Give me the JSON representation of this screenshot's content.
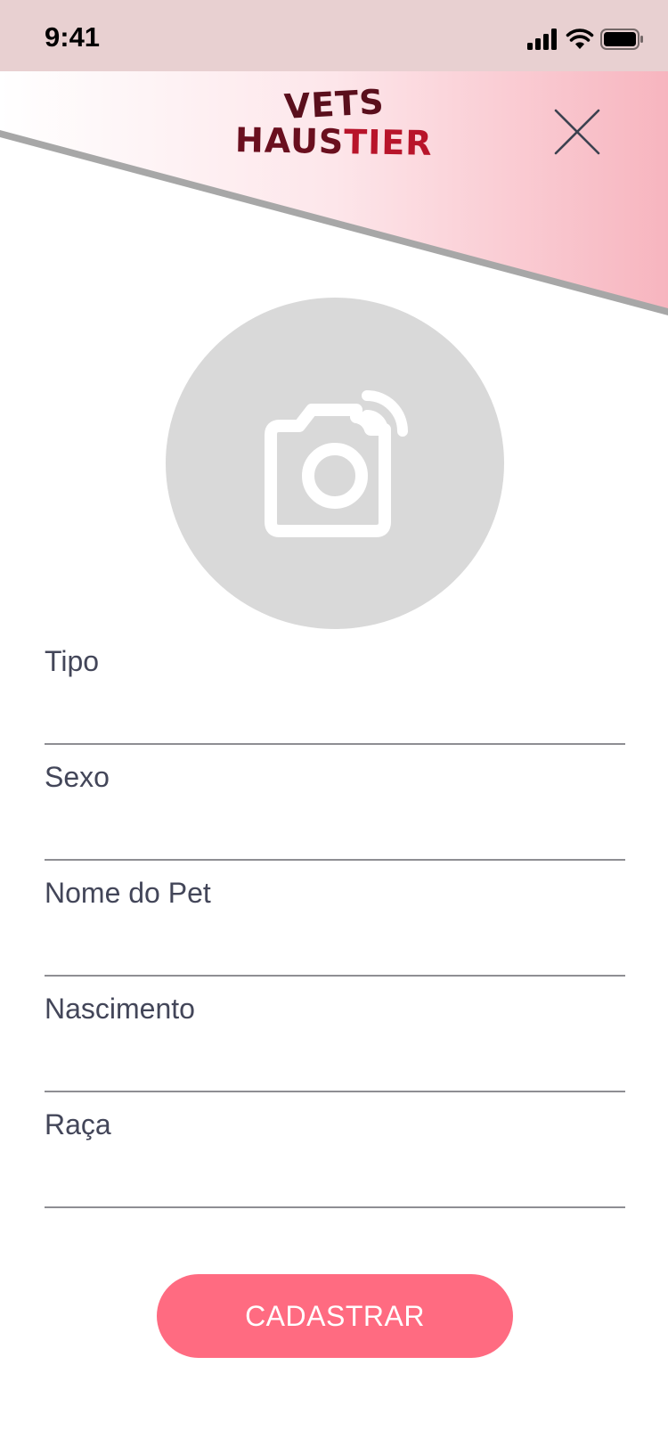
{
  "status_bar": {
    "time": "9:41",
    "icons": [
      "signal-icon",
      "wifi-icon",
      "battery-icon"
    ]
  },
  "header": {
    "logo_line1": "VETS",
    "logo_line2_part1": "HAUS",
    "logo_line2_part2": "TIER",
    "close_icon": "close-icon"
  },
  "photo": {
    "icon": "camera-icon"
  },
  "form": {
    "fields": [
      {
        "label": "Tipo",
        "value": ""
      },
      {
        "label": "Sexo",
        "value": ""
      },
      {
        "label": "Nome do Pet",
        "value": ""
      },
      {
        "label": "Nascimento",
        "value": ""
      },
      {
        "label": "Raça",
        "value": ""
      }
    ]
  },
  "actions": {
    "submit_label": "CADASTRAR"
  },
  "colors": {
    "status_bar_bg": "#e8d0d1",
    "header_gradient_start": "#ffffff",
    "header_gradient_end": "#f7b5bf",
    "accent": "#ff6b81",
    "logo_dark": "#5a0f1c",
    "logo_red": "#b8142a",
    "placeholder_circle": "#d9d9d9",
    "label_text": "#434659"
  }
}
